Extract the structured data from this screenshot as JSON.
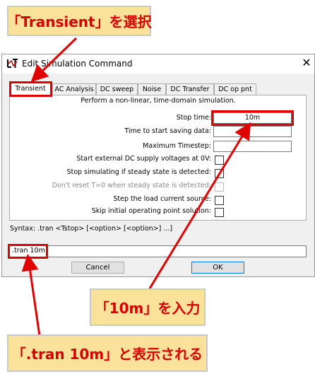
{
  "callouts": {
    "transient": "「Transient」を選択",
    "input_10m": "「10m」を入力",
    "shows_tran": "「.tran 10m」と表示される"
  },
  "dialog": {
    "title": "Edit Simulation Command",
    "close_glyph": "✕",
    "tabs": [
      "Transient",
      "AC Analysis",
      "DC sweep",
      "Noise",
      "DC Transfer",
      "DC op pnt"
    ],
    "description": "Perform a non-linear, time-domain simulation.",
    "fields": {
      "stop_time": {
        "label": "Stop time:",
        "value": "10m"
      },
      "start_saving": {
        "label": "Time to start saving data:",
        "value": ""
      },
      "max_timestep": {
        "label": "Maximum Timestep:",
        "value": ""
      }
    },
    "checkboxes": [
      {
        "label": "Start external DC supply voltages at 0V:",
        "checked": false,
        "enabled": true
      },
      {
        "label": "Stop simulating if steady state is detected:",
        "checked": false,
        "enabled": true
      },
      {
        "label": "Don't reset T=0 when steady state is detected:",
        "checked": false,
        "enabled": false
      },
      {
        "label": "Step the load current source:",
        "checked": false,
        "enabled": true
      },
      {
        "label": "Skip initial operating point solution:",
        "checked": false,
        "enabled": true
      }
    ],
    "syntax": "Syntax:  .tran <Tstop> [<option> [<option>] ...]",
    "command": ".tran 10m",
    "buttons": {
      "cancel": "Cancel",
      "ok": "OK"
    }
  },
  "colors": {
    "callout_bg": "#fbe29a",
    "callout_text": "#d60000",
    "highlight": "#e00000"
  }
}
